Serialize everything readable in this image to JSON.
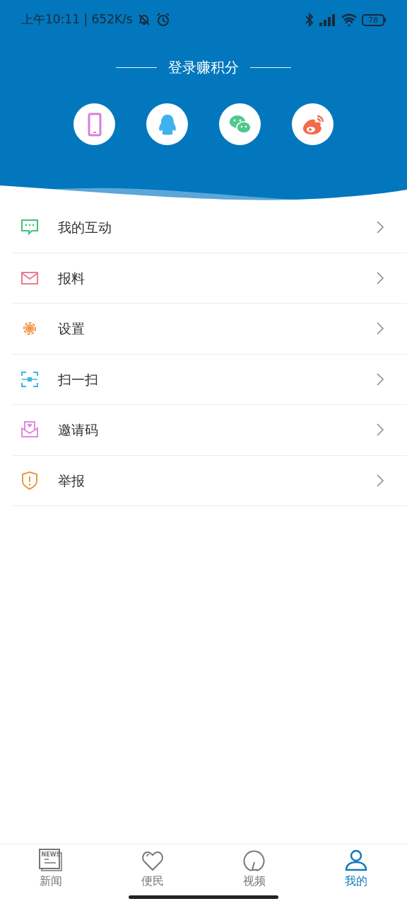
{
  "status_bar": {
    "time": "上午10:11 | 652K/s",
    "battery": "78"
  },
  "login": {
    "title": "登录赚积分",
    "methods": [
      {
        "kind": "phone"
      },
      {
        "kind": "qq"
      },
      {
        "kind": "wechat"
      },
      {
        "kind": "weibo"
      }
    ]
  },
  "menu": [
    {
      "kind": "chat",
      "label": "我的互动"
    },
    {
      "kind": "mail",
      "label": "报料"
    },
    {
      "kind": "gear",
      "label": "设置"
    },
    {
      "kind": "scan",
      "label": "扫一扫"
    },
    {
      "kind": "invite",
      "label": "邀请码"
    },
    {
      "kind": "shield",
      "label": "举报"
    }
  ],
  "tab_bar": [
    {
      "kind": "news",
      "label": "新闻",
      "icon_text": "NEWS",
      "selected": false
    },
    {
      "kind": "heart",
      "label": "便民",
      "selected": false
    },
    {
      "kind": "video",
      "label": "视频",
      "selected": false
    },
    {
      "kind": "user",
      "label": "我的",
      "selected": true
    }
  ]
}
